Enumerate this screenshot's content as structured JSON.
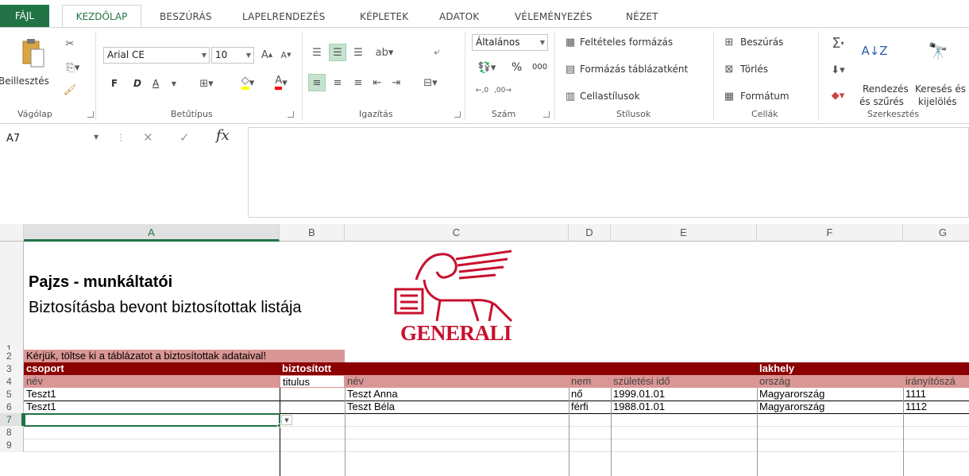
{
  "tabs": {
    "file": "FÁJL",
    "home": "KEZDŐLAP",
    "insert": "BESZÚRÁS",
    "layout": "LAPELRENDEZÉS",
    "formulas": "KÉPLETEK",
    "data": "ADATOK",
    "review": "VÉLEMÉNYEZÉS",
    "view": "NÉZET"
  },
  "ribbon": {
    "clipboard": {
      "paste": "Beillesztés",
      "label": "Vágólap"
    },
    "font": {
      "name": "Arial CE",
      "size": "10",
      "bold": "F",
      "italic": "D",
      "underline": "A",
      "label": "Betűtípus"
    },
    "alignment": {
      "label": "Igazítás"
    },
    "number": {
      "format": "Általános",
      "percent": "%",
      "thousands": "000",
      "label": "Szám"
    },
    "styles": {
      "conditional": "Feltételes formázás",
      "table": "Formázás táblázatként",
      "cell": "Cellastílusok",
      "label": "Stílusok"
    },
    "cells": {
      "insert": "Beszúrás",
      "delete": "Törlés",
      "format": "Formátum",
      "label": "Cellák"
    },
    "editing": {
      "sort1": "Rendezés",
      "sort2": "és szűrés",
      "find1": "Keresés és",
      "find2": "kijelölés",
      "label": "Szerkesztés"
    }
  },
  "formula_bar": {
    "name_box": "A7",
    "fx": "fx",
    "value": ""
  },
  "columns": [
    "A",
    "B",
    "C",
    "D",
    "E",
    "F",
    "G"
  ],
  "rows": [
    "1",
    "2",
    "3",
    "4",
    "5",
    "6",
    "7",
    "8",
    "9"
  ],
  "sheet": {
    "title": "Pajzs - munkáltatói",
    "subtitle": "Biztosításba bevont biztosítottak listája",
    "logo_text": "GENERALI",
    "instruction": "Kérjük, töltse ki a táblázatot a biztosítottak adataival!",
    "group_headers": [
      "csoport",
      "biztosított",
      "lakhely"
    ],
    "sub_headers": [
      "név",
      "titulus",
      "név",
      "nem",
      "születési idő",
      "ország",
      "irányítószá"
    ],
    "data_rows": [
      [
        "Teszt1",
        "",
        "Teszt Anna",
        "nő",
        "1999.01.01",
        "Magyarország",
        "1111"
      ],
      [
        "Teszt1",
        "",
        "Teszt Béla",
        "férfi",
        "1988.01.01",
        "Magyarország",
        "1112"
      ]
    ]
  },
  "colors": {
    "accent": "#217346",
    "dark_red": "#8b0000",
    "pink": "#da9694",
    "logo_red": "#c8102e"
  }
}
